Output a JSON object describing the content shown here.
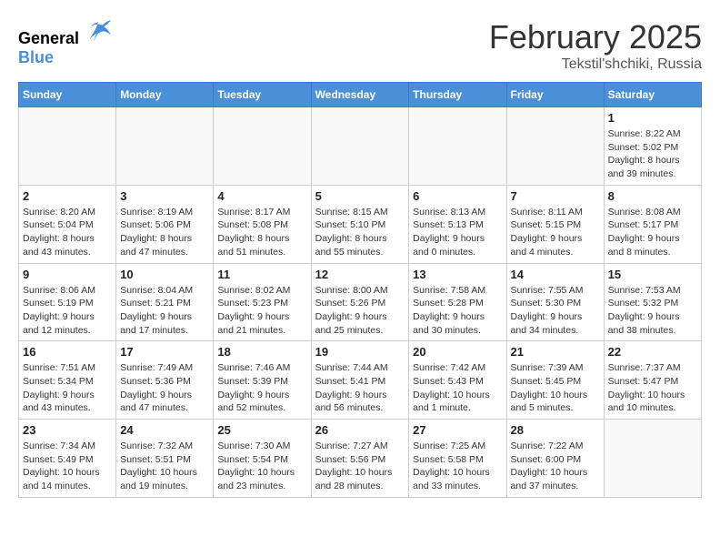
{
  "header": {
    "logo_general": "General",
    "logo_blue": "Blue",
    "month_title": "February 2025",
    "location": "Tekstil'shchiki, Russia"
  },
  "days_of_week": [
    "Sunday",
    "Monday",
    "Tuesday",
    "Wednesday",
    "Thursday",
    "Friday",
    "Saturday"
  ],
  "weeks": [
    [
      {
        "day": "",
        "info": ""
      },
      {
        "day": "",
        "info": ""
      },
      {
        "day": "",
        "info": ""
      },
      {
        "day": "",
        "info": ""
      },
      {
        "day": "",
        "info": ""
      },
      {
        "day": "",
        "info": ""
      },
      {
        "day": "1",
        "info": "Sunrise: 8:22 AM\nSunset: 5:02 PM\nDaylight: 8 hours and 39 minutes."
      }
    ],
    [
      {
        "day": "2",
        "info": "Sunrise: 8:20 AM\nSunset: 5:04 PM\nDaylight: 8 hours and 43 minutes."
      },
      {
        "day": "3",
        "info": "Sunrise: 8:19 AM\nSunset: 5:06 PM\nDaylight: 8 hours and 47 minutes."
      },
      {
        "day": "4",
        "info": "Sunrise: 8:17 AM\nSunset: 5:08 PM\nDaylight: 8 hours and 51 minutes."
      },
      {
        "day": "5",
        "info": "Sunrise: 8:15 AM\nSunset: 5:10 PM\nDaylight: 8 hours and 55 minutes."
      },
      {
        "day": "6",
        "info": "Sunrise: 8:13 AM\nSunset: 5:13 PM\nDaylight: 9 hours and 0 minutes."
      },
      {
        "day": "7",
        "info": "Sunrise: 8:11 AM\nSunset: 5:15 PM\nDaylight: 9 hours and 4 minutes."
      },
      {
        "day": "8",
        "info": "Sunrise: 8:08 AM\nSunset: 5:17 PM\nDaylight: 9 hours and 8 minutes."
      }
    ],
    [
      {
        "day": "9",
        "info": "Sunrise: 8:06 AM\nSunset: 5:19 PM\nDaylight: 9 hours and 12 minutes."
      },
      {
        "day": "10",
        "info": "Sunrise: 8:04 AM\nSunset: 5:21 PM\nDaylight: 9 hours and 17 minutes."
      },
      {
        "day": "11",
        "info": "Sunrise: 8:02 AM\nSunset: 5:23 PM\nDaylight: 9 hours and 21 minutes."
      },
      {
        "day": "12",
        "info": "Sunrise: 8:00 AM\nSunset: 5:26 PM\nDaylight: 9 hours and 25 minutes."
      },
      {
        "day": "13",
        "info": "Sunrise: 7:58 AM\nSunset: 5:28 PM\nDaylight: 9 hours and 30 minutes."
      },
      {
        "day": "14",
        "info": "Sunrise: 7:55 AM\nSunset: 5:30 PM\nDaylight: 9 hours and 34 minutes."
      },
      {
        "day": "15",
        "info": "Sunrise: 7:53 AM\nSunset: 5:32 PM\nDaylight: 9 hours and 38 minutes."
      }
    ],
    [
      {
        "day": "16",
        "info": "Sunrise: 7:51 AM\nSunset: 5:34 PM\nDaylight: 9 hours and 43 minutes."
      },
      {
        "day": "17",
        "info": "Sunrise: 7:49 AM\nSunset: 5:36 PM\nDaylight: 9 hours and 47 minutes."
      },
      {
        "day": "18",
        "info": "Sunrise: 7:46 AM\nSunset: 5:39 PM\nDaylight: 9 hours and 52 minutes."
      },
      {
        "day": "19",
        "info": "Sunrise: 7:44 AM\nSunset: 5:41 PM\nDaylight: 9 hours and 56 minutes."
      },
      {
        "day": "20",
        "info": "Sunrise: 7:42 AM\nSunset: 5:43 PM\nDaylight: 10 hours and 1 minute."
      },
      {
        "day": "21",
        "info": "Sunrise: 7:39 AM\nSunset: 5:45 PM\nDaylight: 10 hours and 5 minutes."
      },
      {
        "day": "22",
        "info": "Sunrise: 7:37 AM\nSunset: 5:47 PM\nDaylight: 10 hours and 10 minutes."
      }
    ],
    [
      {
        "day": "23",
        "info": "Sunrise: 7:34 AM\nSunset: 5:49 PM\nDaylight: 10 hours and 14 minutes."
      },
      {
        "day": "24",
        "info": "Sunrise: 7:32 AM\nSunset: 5:51 PM\nDaylight: 10 hours and 19 minutes."
      },
      {
        "day": "25",
        "info": "Sunrise: 7:30 AM\nSunset: 5:54 PM\nDaylight: 10 hours and 23 minutes."
      },
      {
        "day": "26",
        "info": "Sunrise: 7:27 AM\nSunset: 5:56 PM\nDaylight: 10 hours and 28 minutes."
      },
      {
        "day": "27",
        "info": "Sunrise: 7:25 AM\nSunset: 5:58 PM\nDaylight: 10 hours and 33 minutes."
      },
      {
        "day": "28",
        "info": "Sunrise: 7:22 AM\nSunset: 6:00 PM\nDaylight: 10 hours and 37 minutes."
      },
      {
        "day": "",
        "info": ""
      }
    ]
  ]
}
